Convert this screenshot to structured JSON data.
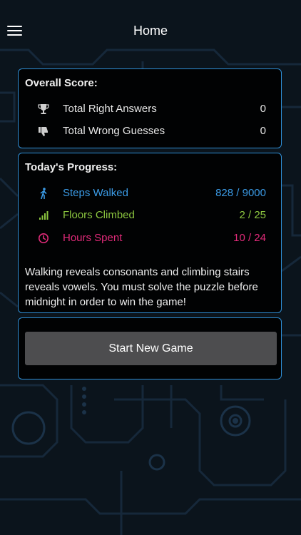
{
  "nav": {
    "title": "Home"
  },
  "score": {
    "title": "Overall Score:",
    "rows": [
      {
        "label": "Total Right Answers",
        "value": "0",
        "icon": "trophy-icon"
      },
      {
        "label": "Total Wrong Guesses",
        "value": "0",
        "icon": "thumbs-down-icon"
      }
    ]
  },
  "progress": {
    "title": "Today's Progress:",
    "rows": [
      {
        "label": "Steps Walked",
        "value": "828 / 9000",
        "icon": "walking-person-icon",
        "color": "#3b9be6"
      },
      {
        "label": "Floors Climbed",
        "value": "2 / 25",
        "icon": "bars-icon",
        "color": "#8cc63f"
      },
      {
        "label": "Hours Spent",
        "value": "10 / 24",
        "icon": "clock-icon",
        "color": "#e22b7a"
      }
    ],
    "description": "Walking reveals consonants and climbing stairs reveals vowels. You must solve the puzzle before midnight in order to win the game!"
  },
  "action": {
    "start_label": "Start New Game"
  },
  "colors": {
    "accent_border": "#2f8fd6",
    "button_bg": "#4d4d4f",
    "background": "#0b141c"
  }
}
